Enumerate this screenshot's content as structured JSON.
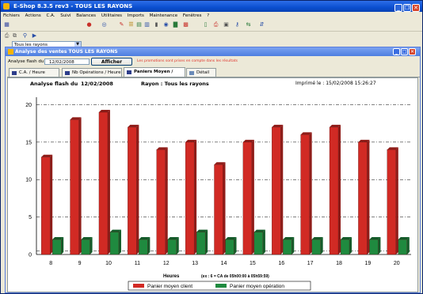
{
  "window": {
    "title": "E-Shop 8.3.5 rev3  -  TOUS LES RAYONS"
  },
  "menu": [
    "Fichiers",
    "Actions",
    "C.A.",
    "Suivi",
    "Balances",
    "Utilitaires",
    "Imports",
    "Maintenance",
    "Fenêtres",
    "?"
  ],
  "toolbar": {
    "department_select": "Tous les rayons"
  },
  "child_window": {
    "title": "Analyse des ventes TOUS LES RAYONS"
  },
  "filter": {
    "label": "Analyse flash du",
    "date": "12/02/2008",
    "button": "Afficher",
    "notice": "Les promotions sont prises en compte dans les résultats"
  },
  "tabs": [
    {
      "label": "C.A. / Heure"
    },
    {
      "label": "Nb Opérations / Heure"
    },
    {
      "label": "Paniers Moyen / Heure"
    },
    {
      "label": "Détail"
    }
  ],
  "report": {
    "title_label": "Analyse flash du",
    "title_date": "12/02/2008",
    "rayon": "Rayon :  Tous les rayons",
    "printed": "Imprimé le : 15/02/2008 15:26:27"
  },
  "chart_data": {
    "type": "bar",
    "categories": [
      "8",
      "9",
      "10",
      "11",
      "12",
      "13",
      "14",
      "15",
      "16",
      "17",
      "18",
      "19",
      "20"
    ],
    "series": [
      {
        "name": "Panier moyen client",
        "color": "#d12a24",
        "values": [
          13,
          18,
          19,
          17,
          14,
          15,
          12,
          15,
          17,
          16,
          17,
          15,
          14
        ]
      },
      {
        "name": "Panier moyen opération",
        "color": "#1f8a3f",
        "values": [
          2,
          2,
          3,
          2,
          2,
          3,
          2,
          3,
          2,
          2,
          2,
          2,
          2
        ]
      }
    ],
    "xlabel": "Heures",
    "xnote": "(ex : 6 = CA de 05h00:00 à 05h59:59)",
    "yticks": [
      0,
      5,
      10,
      15,
      20
    ],
    "ylim": [
      0,
      21
    ],
    "grid": true,
    "legend": "bottom"
  }
}
